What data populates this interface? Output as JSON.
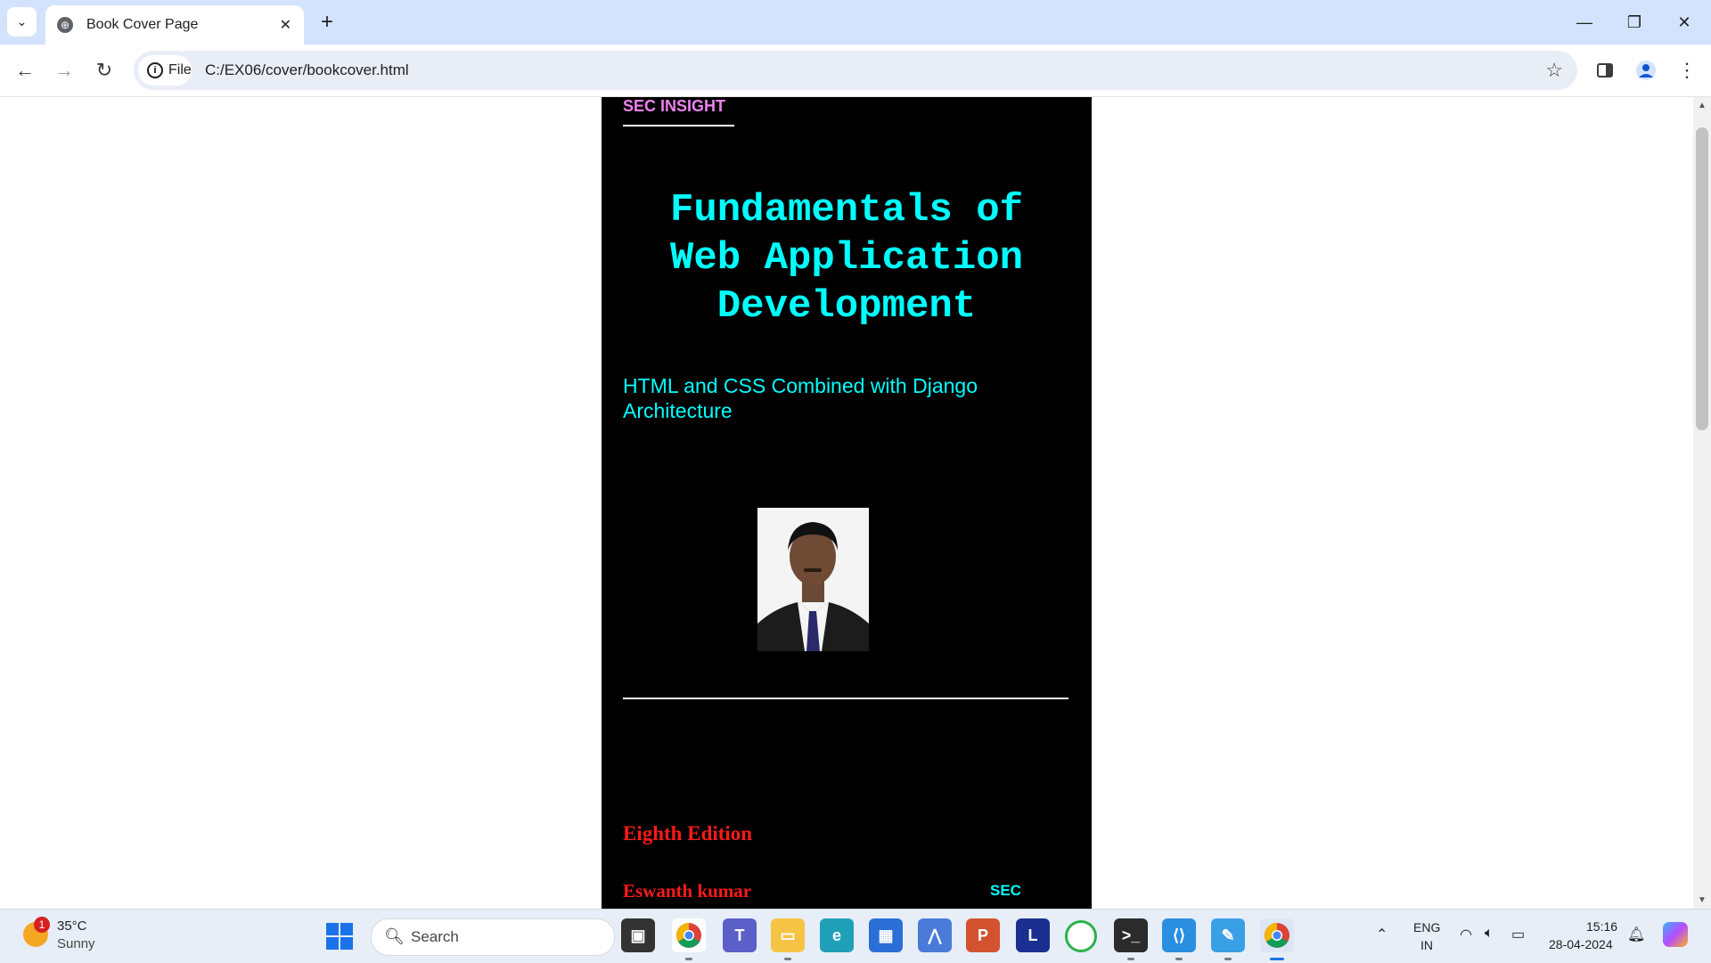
{
  "browser": {
    "tab_title": "Book Cover Page",
    "new_tab": "+",
    "url": "C:/EX06/cover/bookcover.html",
    "site_info_label": "File"
  },
  "cover": {
    "brand": "SEC INSIGHT",
    "title_line1": "Fundamentals of",
    "title_line2": "Web Application",
    "title_line3": "Development",
    "subtitle": "HTML and CSS Combined with Django Architecture",
    "edition": "Eighth Edition",
    "author": "Eswanth kumar",
    "publisher": "SEC",
    "colors": {
      "title": "#00ffff",
      "brand": "#ee82ee",
      "edition": "#ff1a1a",
      "background": "#000000"
    }
  },
  "taskbar": {
    "weather_temp": "35°C",
    "weather_condition": "Sunny",
    "weather_badge": "1",
    "search_placeholder": "Search",
    "lang_line1": "ENG",
    "lang_line2": "IN",
    "time": "15:16",
    "date": "28-04-2024",
    "apps": [
      "file-explorer-icon",
      "chrome-icon",
      "teams-icon",
      "folder-icon",
      "edge-icon",
      "store-icon",
      "app-icon",
      "powerpoint-icon",
      "l-app-icon",
      "circle-app-icon",
      "terminal-icon",
      "vscode-icon",
      "paint-icon",
      "chrome-active-icon"
    ]
  }
}
